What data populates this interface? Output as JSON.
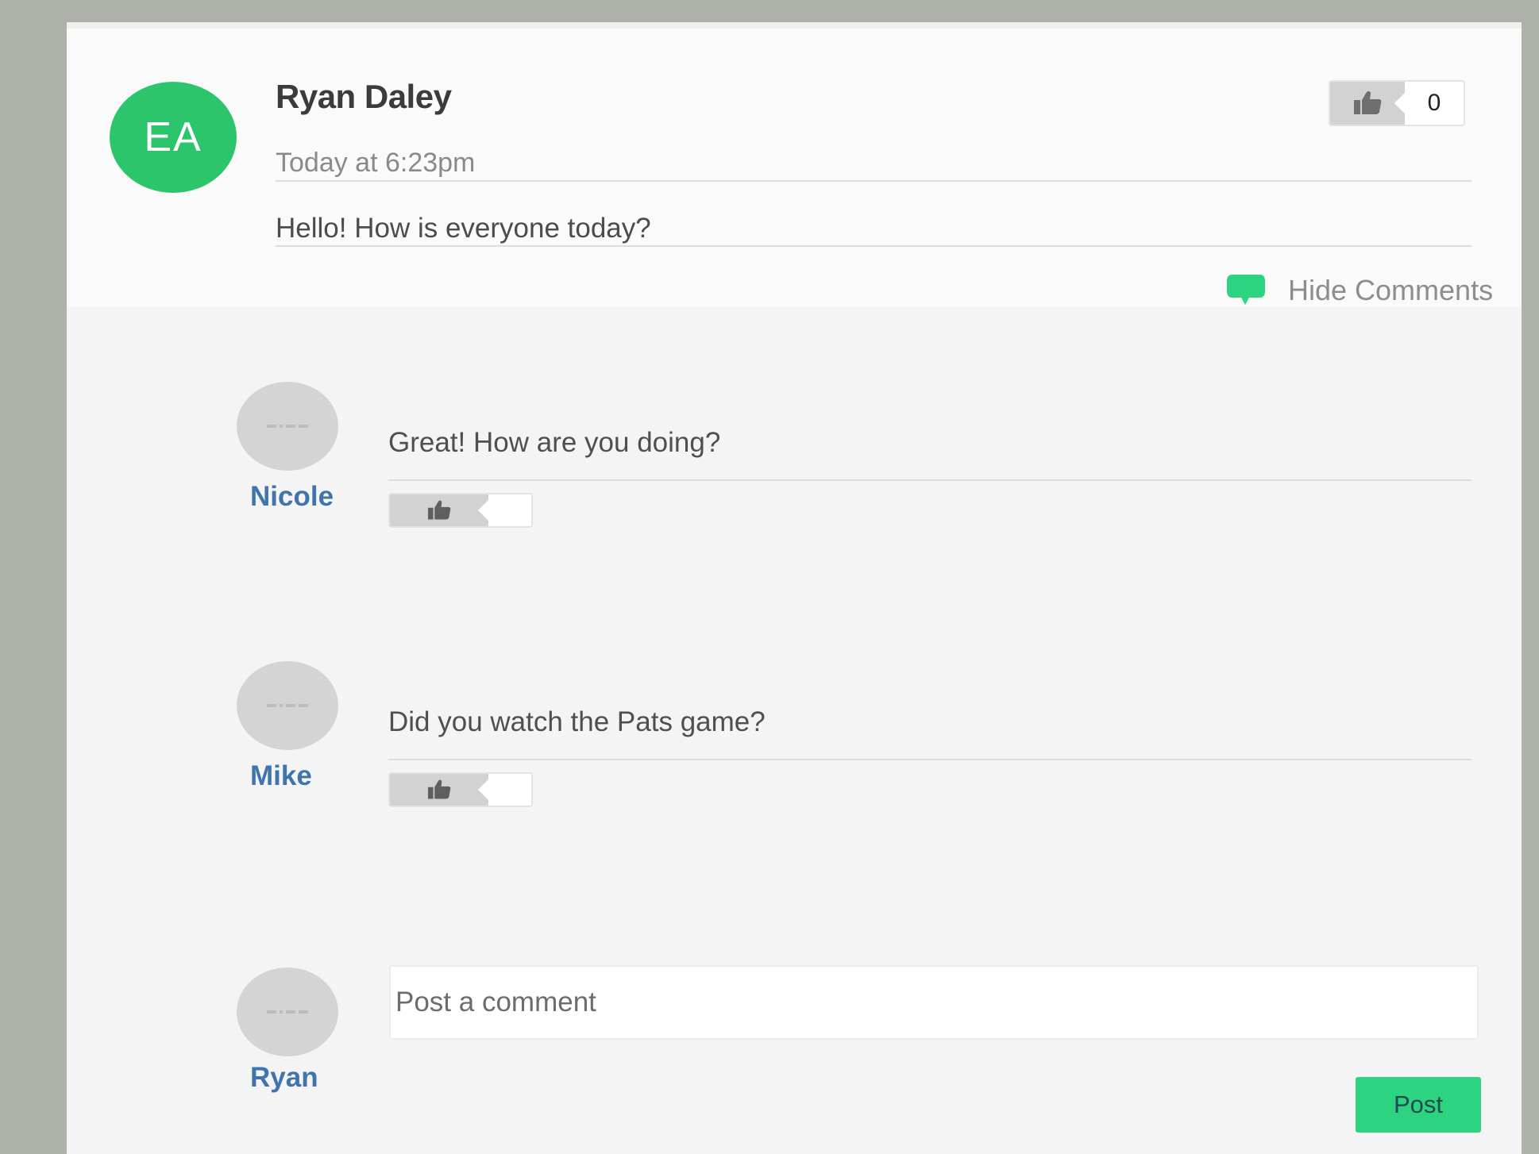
{
  "post": {
    "avatar_initials": "EA",
    "author": "Ryan Daley",
    "timestamp": "Today at 6:23pm",
    "body": "Hello! How is everyone today?",
    "likes": {
      "icon": "thumbs-up-icon",
      "count": "0"
    },
    "toggle": {
      "icon": "speech-bubble-icon",
      "label": "Hide Comments"
    }
  },
  "comments": [
    {
      "author": "Nicole",
      "text": "Great! How are you doing?",
      "like_icon": "thumbs-up-icon"
    },
    {
      "author": "Mike",
      "text": "Did you watch the Pats game?",
      "like_icon": "thumbs-up-icon"
    }
  ],
  "composer": {
    "author": "Ryan",
    "placeholder": "Post a comment",
    "submit_label": "Post"
  },
  "colors": {
    "page_background": "#aeb0aa",
    "avatar_green": "#2dc56b",
    "accent_green": "#2dd47f",
    "name_blue": "#3f74ad"
  }
}
